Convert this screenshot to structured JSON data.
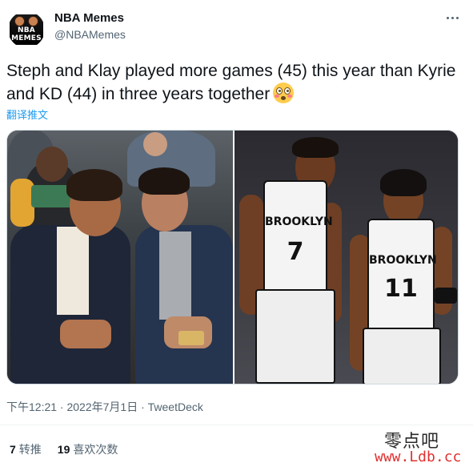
{
  "author": {
    "display_name": "NBA Memes",
    "handle": "@NBAMemes",
    "avatar_text_line1": "NBA",
    "avatar_text_line2": "MEMES"
  },
  "tweet": {
    "text": "Steph and Klay played more games (45) this year than Kyrie and KD (44) in three years together",
    "emoji": "flushed-face",
    "translate_label": "翻译推文",
    "timestamp": "下午12:21 · 2022年7月1日 · TweetDeck"
  },
  "media": {
    "left_photo": "two-players-courtside",
    "right_photo": "two-brooklyn-players",
    "jersey_team": "BROOKLYN",
    "jersey_numbers": [
      "7",
      "11"
    ]
  },
  "stats": {
    "retweets_count": "7",
    "retweets_label": "转推",
    "likes_count": "19",
    "likes_label": "喜欢次数"
  },
  "watermark": {
    "line1": "零点吧",
    "line2": "www.Ldb.cc"
  },
  "colors": {
    "link": "#1d9bf0",
    "secondary_text": "#536471",
    "primary_text": "#0f1419",
    "watermark_url": "#e03030"
  }
}
